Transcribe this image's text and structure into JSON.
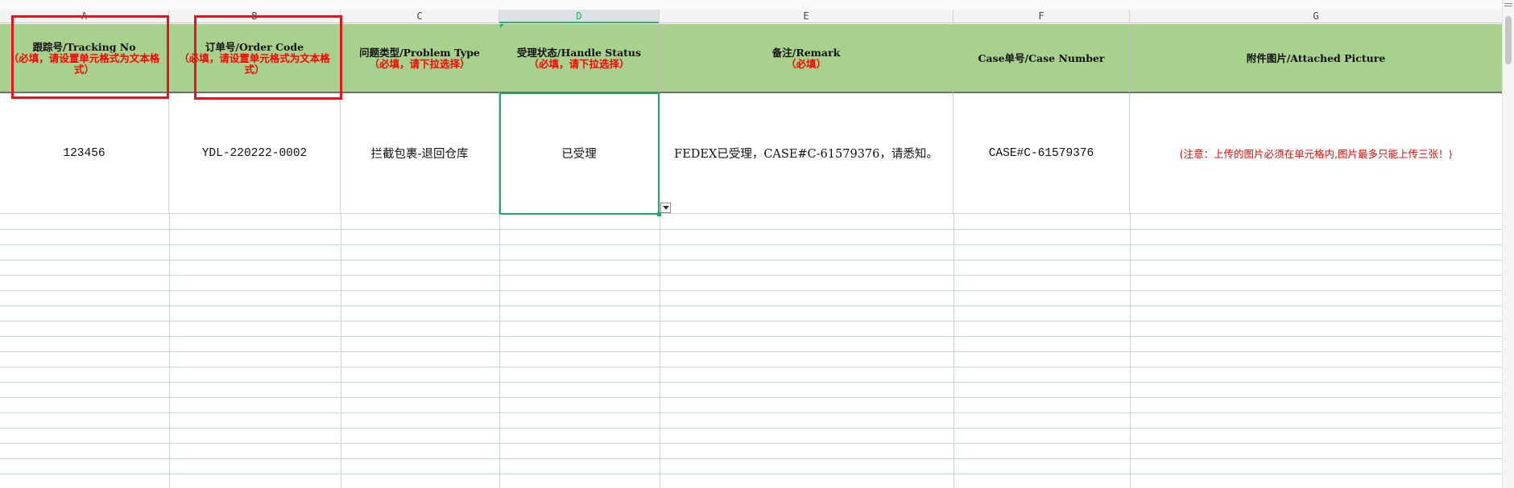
{
  "columns": [
    "A",
    "B",
    "C",
    "D",
    "E",
    "F",
    "G"
  ],
  "selected_column": "D",
  "headers": {
    "a": {
      "main": "跟踪号/Tracking No",
      "sub": "（必填，请设置单元格式为文本格式）"
    },
    "b": {
      "main": "订单号/Order Code",
      "sub": "（必填，请设置单元格式为文本格式）"
    },
    "c": {
      "main": "问题类型/Problem Type",
      "sub": "（必填，请下拉选择）"
    },
    "d": {
      "main": "受理状态/Handle Status",
      "sub": "（必填，请下拉选择）"
    },
    "e": {
      "main": "备注/Remark",
      "sub": "（必填）"
    },
    "f": {
      "main": "Case单号/Case Number"
    },
    "g": {
      "main": "附件图片/Attached Picture"
    }
  },
  "row1": {
    "a": "123456",
    "b": "YDL-220222-0002",
    "c": "拦截包裹-退回仓库",
    "d": "已受理",
    "e": "FEDEX已受理，CASE#C-61579376，请悉知。",
    "f": "CASE#C-61579376",
    "g": "(注意：上传的图片必须在单元格内,图片最多只能上传三张！)"
  },
  "colors": {
    "header_fill": "#a9d18e",
    "required_text": "#ff0000",
    "active_border": "#1aaa62",
    "annotation_box": "#e8141d"
  }
}
